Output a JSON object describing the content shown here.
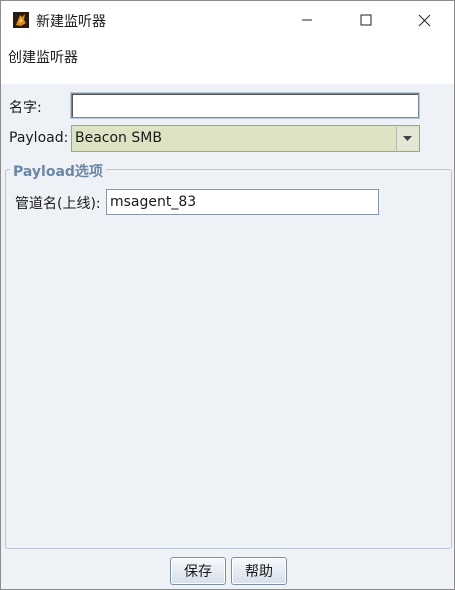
{
  "window": {
    "title": "新建监听器",
    "app_icon": "cobalt-strike-app-icon",
    "controls": [
      "minimize-icon",
      "maximize-icon",
      "close-icon"
    ]
  },
  "banner": {
    "text": "创建监听器"
  },
  "form": {
    "name_label": "名字:",
    "name_value": "",
    "payload_label": "Payload:",
    "payload_value": "Beacon SMB"
  },
  "group": {
    "title": "Payload选项",
    "pipe_label": "管道名(上线):",
    "pipe_value": "msagent_83"
  },
  "buttons": {
    "save": "保存",
    "help": "帮助"
  }
}
